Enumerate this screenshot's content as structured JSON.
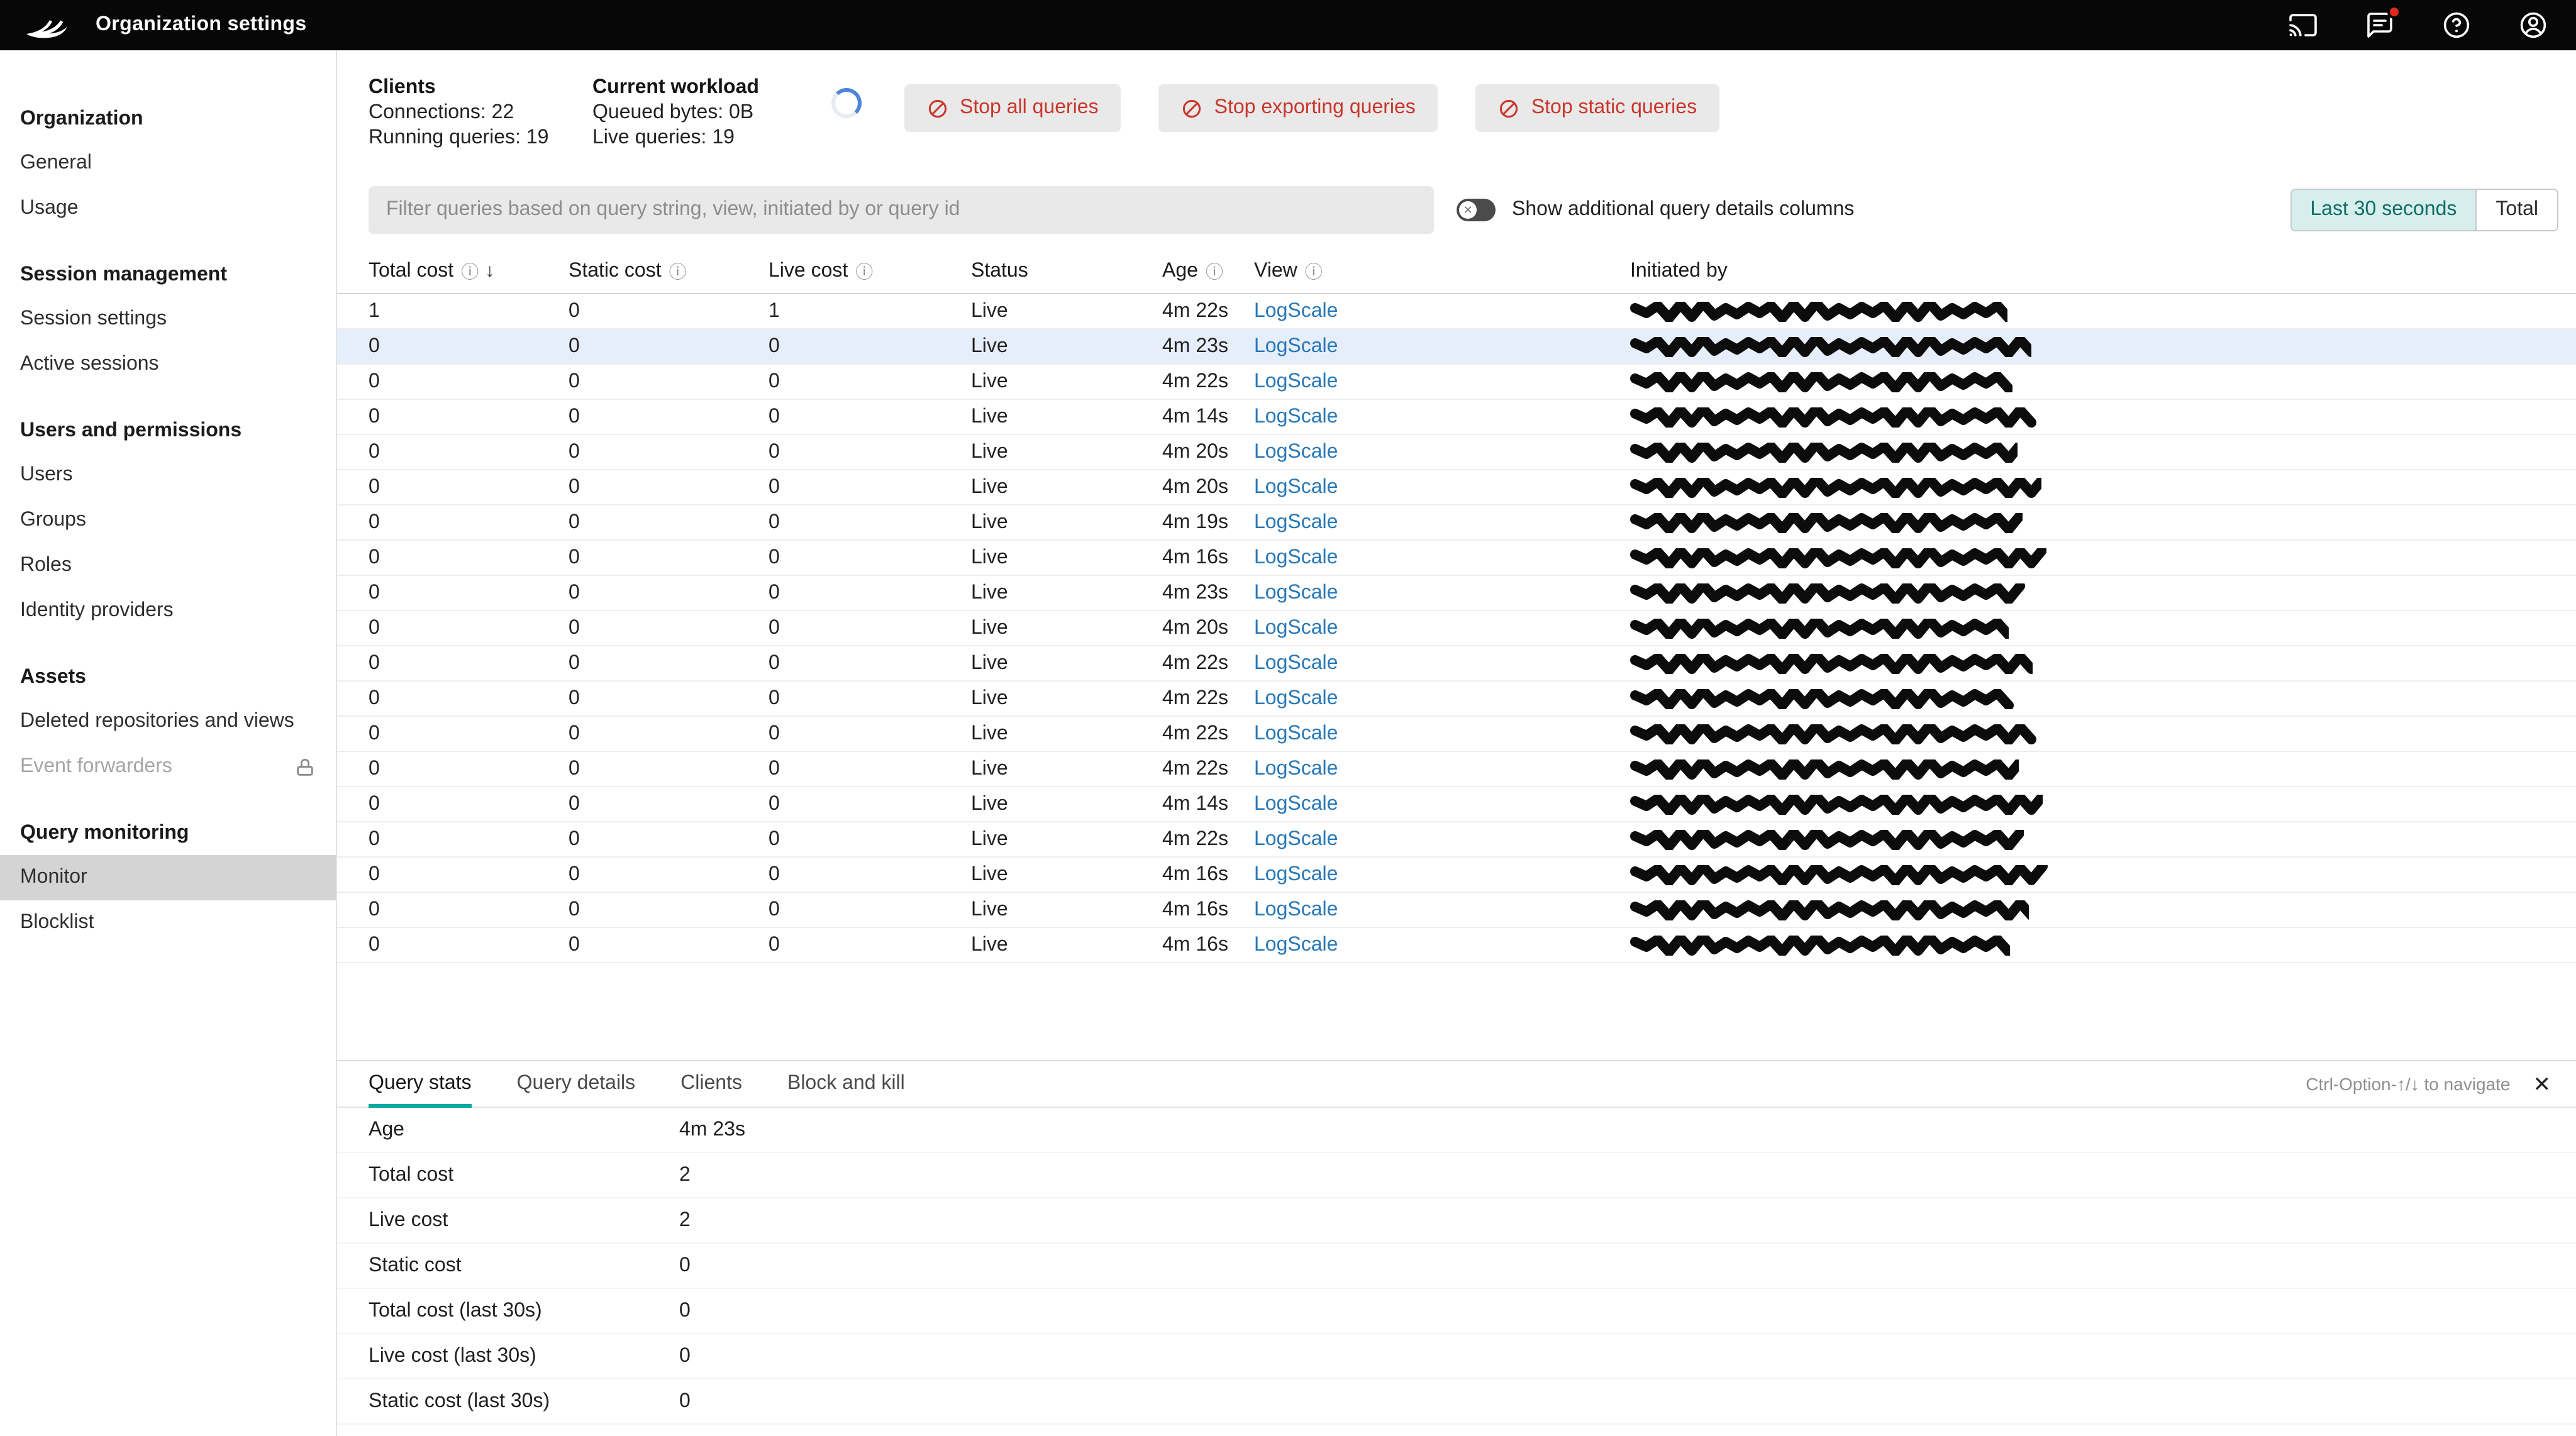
{
  "topbar": {
    "title": "Organization settings"
  },
  "sidebar": {
    "sections": [
      {
        "heading": "Organization",
        "items": [
          {
            "label": "General"
          },
          {
            "label": "Usage"
          }
        ]
      },
      {
        "heading": "Session management",
        "items": [
          {
            "label": "Session settings"
          },
          {
            "label": "Active sessions"
          }
        ]
      },
      {
        "heading": "Users and permissions",
        "items": [
          {
            "label": "Users"
          },
          {
            "label": "Groups"
          },
          {
            "label": "Roles"
          },
          {
            "label": "Identity providers"
          }
        ]
      },
      {
        "heading": "Assets",
        "items": [
          {
            "label": "Deleted repositories and views"
          },
          {
            "label": "Event forwarders",
            "disabled": true,
            "locked": true
          }
        ]
      },
      {
        "heading": "Query monitoring",
        "items": [
          {
            "label": "Monitor",
            "active": true
          },
          {
            "label": "Blocklist"
          }
        ]
      }
    ]
  },
  "workload": {
    "clients_title": "Clients",
    "clients_line1": "Connections: 22",
    "clients_line2": "Running queries: 19",
    "current_title": "Current workload",
    "current_line1": "Queued bytes: 0B",
    "current_line2": "Live queries: 19",
    "actions": [
      {
        "label": "Stop all queries"
      },
      {
        "label": "Stop exporting queries"
      },
      {
        "label": "Stop static queries"
      }
    ],
    "action_color": "#c9362b"
  },
  "filterbar": {
    "placeholder": "Filter queries based on query string, view, initiated by or query id",
    "toggle_label": "Show additional query details columns",
    "toggle_state": "off",
    "range_buttons": [
      {
        "label": "Last 30 seconds",
        "active": true
      },
      {
        "label": "Total",
        "active": false
      }
    ],
    "active_range_color": "#0c6e66"
  },
  "table": {
    "columns": [
      {
        "label": "Total cost",
        "info": true,
        "sorted": "desc"
      },
      {
        "label": "Static cost",
        "info": true
      },
      {
        "label": "Live cost",
        "info": true
      },
      {
        "label": "Status"
      },
      {
        "label": "Age",
        "info": true
      },
      {
        "label": "View",
        "info": true
      },
      {
        "label": "Initiated by"
      }
    ],
    "link_color": "#2878b8",
    "rows": [
      {
        "total_cost": "1",
        "static_cost": "0",
        "live_cost": "1",
        "status": "Live",
        "age": "4m 22s",
        "view": "LogScale",
        "initiated_by_redacted": true
      },
      {
        "total_cost": "0",
        "static_cost": "0",
        "live_cost": "0",
        "status": "Live",
        "age": "4m 23s",
        "view": "LogScale",
        "initiated_by_redacted": true,
        "selected": true
      },
      {
        "total_cost": "0",
        "static_cost": "0",
        "live_cost": "0",
        "status": "Live",
        "age": "4m 22s",
        "view": "LogScale",
        "initiated_by_redacted": true
      },
      {
        "total_cost": "0",
        "static_cost": "0",
        "live_cost": "0",
        "status": "Live",
        "age": "4m 14s",
        "view": "LogScale",
        "initiated_by_redacted": true
      },
      {
        "total_cost": "0",
        "static_cost": "0",
        "live_cost": "0",
        "status": "Live",
        "age": "4m 20s",
        "view": "LogScale",
        "initiated_by_redacted": true
      },
      {
        "total_cost": "0",
        "static_cost": "0",
        "live_cost": "0",
        "status": "Live",
        "age": "4m 20s",
        "view": "LogScale",
        "initiated_by_redacted": true
      },
      {
        "total_cost": "0",
        "static_cost": "0",
        "live_cost": "0",
        "status": "Live",
        "age": "4m 19s",
        "view": "LogScale",
        "initiated_by_redacted": true
      },
      {
        "total_cost": "0",
        "static_cost": "0",
        "live_cost": "0",
        "status": "Live",
        "age": "4m 16s",
        "view": "LogScale",
        "initiated_by_redacted": true
      },
      {
        "total_cost": "0",
        "static_cost": "0",
        "live_cost": "0",
        "status": "Live",
        "age": "4m 23s",
        "view": "LogScale",
        "initiated_by_redacted": true
      },
      {
        "total_cost": "0",
        "static_cost": "0",
        "live_cost": "0",
        "status": "Live",
        "age": "4m 20s",
        "view": "LogScale",
        "initiated_by_redacted": true
      },
      {
        "total_cost": "0",
        "static_cost": "0",
        "live_cost": "0",
        "status": "Live",
        "age": "4m 22s",
        "view": "LogScale",
        "initiated_by_redacted": true
      },
      {
        "total_cost": "0",
        "static_cost": "0",
        "live_cost": "0",
        "status": "Live",
        "age": "4m 22s",
        "view": "LogScale",
        "initiated_by_redacted": true
      },
      {
        "total_cost": "0",
        "static_cost": "0",
        "live_cost": "0",
        "status": "Live",
        "age": "4m 22s",
        "view": "LogScale",
        "initiated_by_redacted": true
      },
      {
        "total_cost": "0",
        "static_cost": "0",
        "live_cost": "0",
        "status": "Live",
        "age": "4m 22s",
        "view": "LogScale",
        "initiated_by_redacted": true
      },
      {
        "total_cost": "0",
        "static_cost": "0",
        "live_cost": "0",
        "status": "Live",
        "age": "4m 14s",
        "view": "LogScale",
        "initiated_by_redacted": true
      },
      {
        "total_cost": "0",
        "static_cost": "0",
        "live_cost": "0",
        "status": "Live",
        "age": "4m 22s",
        "view": "LogScale",
        "initiated_by_redacted": true
      },
      {
        "total_cost": "0",
        "static_cost": "0",
        "live_cost": "0",
        "status": "Live",
        "age": "4m 16s",
        "view": "LogScale",
        "initiated_by_redacted": true
      },
      {
        "total_cost": "0",
        "static_cost": "0",
        "live_cost": "0",
        "status": "Live",
        "age": "4m 16s",
        "view": "LogScale",
        "initiated_by_redacted": true
      },
      {
        "total_cost": "0",
        "static_cost": "0",
        "live_cost": "0",
        "status": "Live",
        "age": "4m 16s",
        "view": "LogScale",
        "initiated_by_redacted": true
      }
    ]
  },
  "details": {
    "tabs": [
      {
        "label": "Query stats",
        "active": true
      },
      {
        "label": "Query details"
      },
      {
        "label": "Clients"
      },
      {
        "label": "Block and kill"
      }
    ],
    "active_tab_color": "#0ba9a0",
    "shortcut_hint": "Ctrl-Option-↑/↓ to navigate",
    "stats": [
      {
        "label": "Age",
        "value": "4m 23s"
      },
      {
        "label": "Total cost",
        "value": "2"
      },
      {
        "label": "Live cost",
        "value": "2"
      },
      {
        "label": "Static cost",
        "value": "0"
      },
      {
        "label": "Total cost (last 30s)",
        "value": "0"
      },
      {
        "label": "Live cost (last 30s)",
        "value": "0"
      },
      {
        "label": "Static cost (last 30s)",
        "value": "0"
      }
    ]
  }
}
